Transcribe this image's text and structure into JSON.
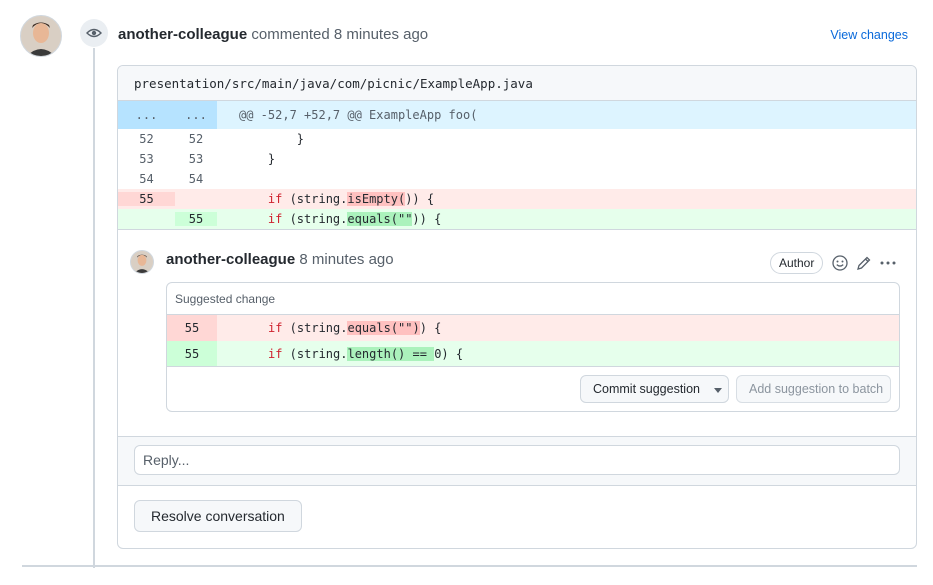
{
  "header": {
    "author": "another-colleague",
    "action": "commented 8 minutes ago",
    "view_changes": "View changes"
  },
  "diff": {
    "file_path": "presentation/src/main/java/com/picnic/ExampleApp.java",
    "hunk": {
      "left": "...",
      "right": "...",
      "text": "@@ -52,7 +52,7 @@ ExampleApp foo("
    },
    "lines": [
      {
        "type": "context",
        "old": "52",
        "new": "52",
        "indent": "        ",
        "code": "}"
      },
      {
        "type": "context",
        "old": "53",
        "new": "53",
        "indent": "    ",
        "code": "}"
      },
      {
        "type": "context",
        "old": "54",
        "new": "54",
        "indent": "",
        "code": ""
      },
      {
        "type": "del",
        "old": "55",
        "new": "",
        "indent": "    ",
        "kw": "if",
        "pre": " (string.",
        "hl": "isEmpty(",
        "post": ")) {"
      },
      {
        "type": "add",
        "old": "",
        "new": "55",
        "indent": "    ",
        "kw": "if",
        "pre": " (string.",
        "hl": "equals(\"\"",
        "post": ")) {"
      }
    ]
  },
  "comment": {
    "author": "another-colleague",
    "time": "8 minutes ago",
    "badge": "Author",
    "suggestion": {
      "title": "Suggested change",
      "del": {
        "num": "55",
        "kw": "if",
        "pre": " (string.",
        "hl": "equals(\"\")",
        "post": ") {"
      },
      "add": {
        "num": "55",
        "kw": "if",
        "pre": " (string.",
        "hl": "length() == ",
        "post_hl": "0",
        "post": ") {"
      },
      "commit_label": "Commit suggestion",
      "batch_label": "Add suggestion to batch"
    }
  },
  "reply": {
    "placeholder": "Reply..."
  },
  "resolve_label": "Resolve conversation"
}
